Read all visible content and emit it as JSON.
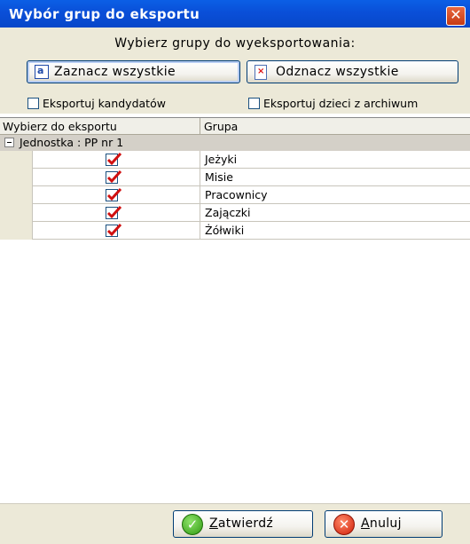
{
  "window": {
    "title": "Wybór grup do eksportu",
    "close_glyph": "✕"
  },
  "top": {
    "prompt": "Wybierz grupy do wyeksportowania:",
    "select_all": {
      "label": "Zaznacz wszystkie",
      "icon": "select-all-icon"
    },
    "deselect_all": {
      "label": "Odznacz wszystkie",
      "icon": "deselect-all-icon"
    },
    "options": [
      {
        "label": "Eksportuj kandydatów",
        "checked": false
      },
      {
        "label": "Eksportuj dzieci z archiwum",
        "checked": false
      }
    ]
  },
  "grid": {
    "columns": [
      "Wybierz do eksportu",
      "Grupa"
    ],
    "group": {
      "label": "Jednostka : PP nr 1",
      "expanded": true
    },
    "rows": [
      {
        "name": "Jeżyki",
        "checked": true
      },
      {
        "name": "Misie",
        "checked": true
      },
      {
        "name": "Pracownicy",
        "checked": true
      },
      {
        "name": "Zajączki",
        "checked": true
      },
      {
        "name": "Żółwiki",
        "checked": true
      }
    ]
  },
  "footer": {
    "ok": {
      "mnemonic": "Z",
      "rest": "atwierdź",
      "icon": "check-circle-icon"
    },
    "cancel": {
      "mnemonic": "A",
      "rest": "nuluj",
      "icon": "cancel-circle-icon"
    }
  },
  "colors": {
    "titlebar": "#0a4fd8",
    "panel": "#ece9d8",
    "check": "#d01010"
  }
}
